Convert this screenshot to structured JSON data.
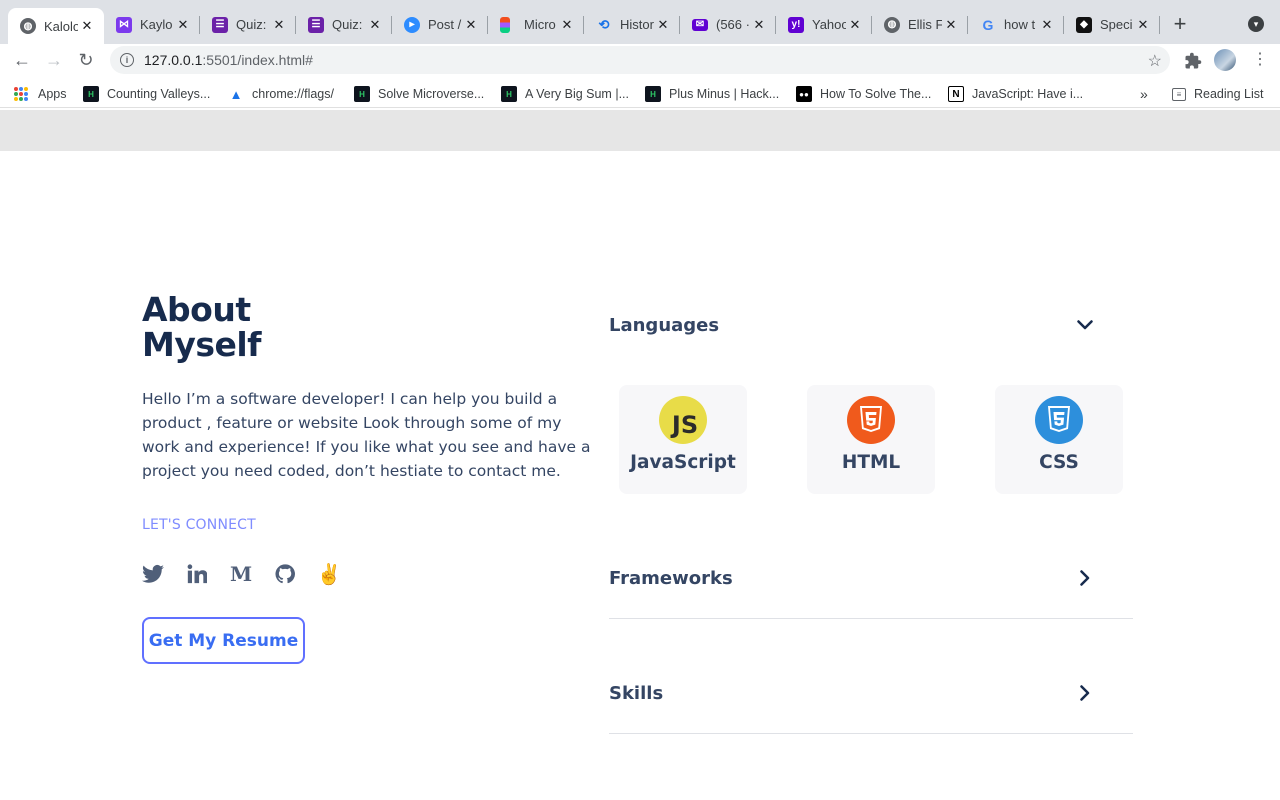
{
  "browser": {
    "tabs": [
      {
        "title": "Kalolo",
        "icon": "globe-icon",
        "active": true
      },
      {
        "title": "Kaylo",
        "icon": "kaylo-icon",
        "active": false
      },
      {
        "title": "Quiz:",
        "icon": "quiz-icon",
        "active": false
      },
      {
        "title": "Quiz:",
        "icon": "quiz-icon",
        "active": false
      },
      {
        "title": "Post /",
        "icon": "zoom-icon",
        "active": false
      },
      {
        "title": "Micro",
        "icon": "figma-icon",
        "active": false
      },
      {
        "title": "Histor",
        "icon": "history-icon",
        "active": false
      },
      {
        "title": "(566 ·",
        "icon": "mail-icon",
        "active": false
      },
      {
        "title": "Yahoo",
        "icon": "yahoo-icon",
        "active": false
      },
      {
        "title": "Ellis F",
        "icon": "globe-icon",
        "active": false
      },
      {
        "title": "how t",
        "icon": "google-icon",
        "active": false
      },
      {
        "title": "Speci",
        "icon": "spec-icon",
        "active": false
      }
    ],
    "url_host": "127.0.0.1",
    "url_path": ":5501/index.html#",
    "bookmarks": [
      {
        "label": "Apps",
        "icon": "apps-grid-icon"
      },
      {
        "label": "Counting Valleys...",
        "icon": "hackerrank-icon"
      },
      {
        "label": "chrome://flags/",
        "icon": "flask-icon"
      },
      {
        "label": "Solve Microverse...",
        "icon": "hackerrank-icon"
      },
      {
        "label": "A Very Big Sum |...",
        "icon": "hackerrank-icon"
      },
      {
        "label": "Plus Minus | Hack...",
        "icon": "hackerrank-icon"
      },
      {
        "label": "How To Solve The...",
        "icon": "medium-icon"
      },
      {
        "label": "JavaScript: Have i...",
        "icon": "notion-icon"
      }
    ],
    "reading_list": "Reading List"
  },
  "about": {
    "title_line1": "About",
    "title_line2": "Myself",
    "text": "Hello I’m a software developer! I can help you build a product , feature or website Look through some of my work and experience! If you like what you see and have a project you need coded, don’t hestiate to contact me.",
    "connect_label": "LET'S CONNECT",
    "socials": [
      "twitter-icon",
      "linkedin-icon",
      "medium-icon",
      "github-icon",
      "angellist-icon"
    ],
    "resume_label": "Get My Resume"
  },
  "sections": {
    "languages": {
      "label": "Languages",
      "expanded": true
    },
    "frameworks": {
      "label": "Frameworks",
      "expanded": false
    },
    "skills": {
      "label": "Skills",
      "expanded": false
    }
  },
  "languages": [
    {
      "name": "JavaScript",
      "icon": "javascript-icon",
      "badge": "JS",
      "color": "#e8dc48"
    },
    {
      "name": "HTML",
      "icon": "html5-icon",
      "badge": "5",
      "color": "#f05a1c"
    },
    {
      "name": "CSS",
      "icon": "css3-icon",
      "badge": "3",
      "color": "#2d8fdc"
    }
  ],
  "colors": {
    "heading": "#172b4d",
    "body_text": "#344563",
    "accent": "#7f8cff",
    "button_border": "#6070ff",
    "button_text": "#396df2"
  }
}
